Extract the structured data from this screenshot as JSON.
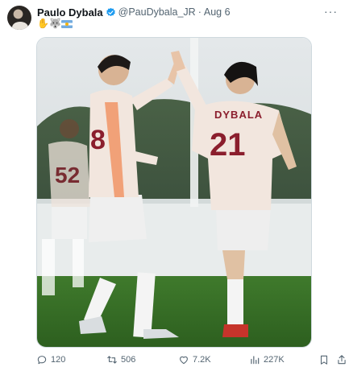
{
  "tweet": {
    "author_name": "Paulo Dybala",
    "handle": "@PauDybala_JR",
    "separator": "·",
    "date": "Aug 6",
    "more_label": "···",
    "emojis": [
      {
        "name": "raised-hand-emoji",
        "glyph": "✋"
      },
      {
        "name": "wolf-emoji",
        "glyph": "🐺"
      },
      {
        "name": "argentina-flag-emoji",
        "glyph": ""
      }
    ]
  },
  "photo": {
    "player_left": {
      "number": "8"
    },
    "player_right": {
      "surname": "DYBALA",
      "number": "21"
    },
    "player_background": {
      "number": "52"
    }
  },
  "actions": {
    "replies": "120",
    "reposts": "506",
    "likes": "7.2K",
    "views": "227K"
  },
  "colors": {
    "text_primary": "#0f1419",
    "text_secondary": "#536471",
    "verified_badge": "#1d9bf0",
    "border": "#cfd9de",
    "kit_number": "#8b1e2d",
    "kit_trim": "#f08a55"
  }
}
